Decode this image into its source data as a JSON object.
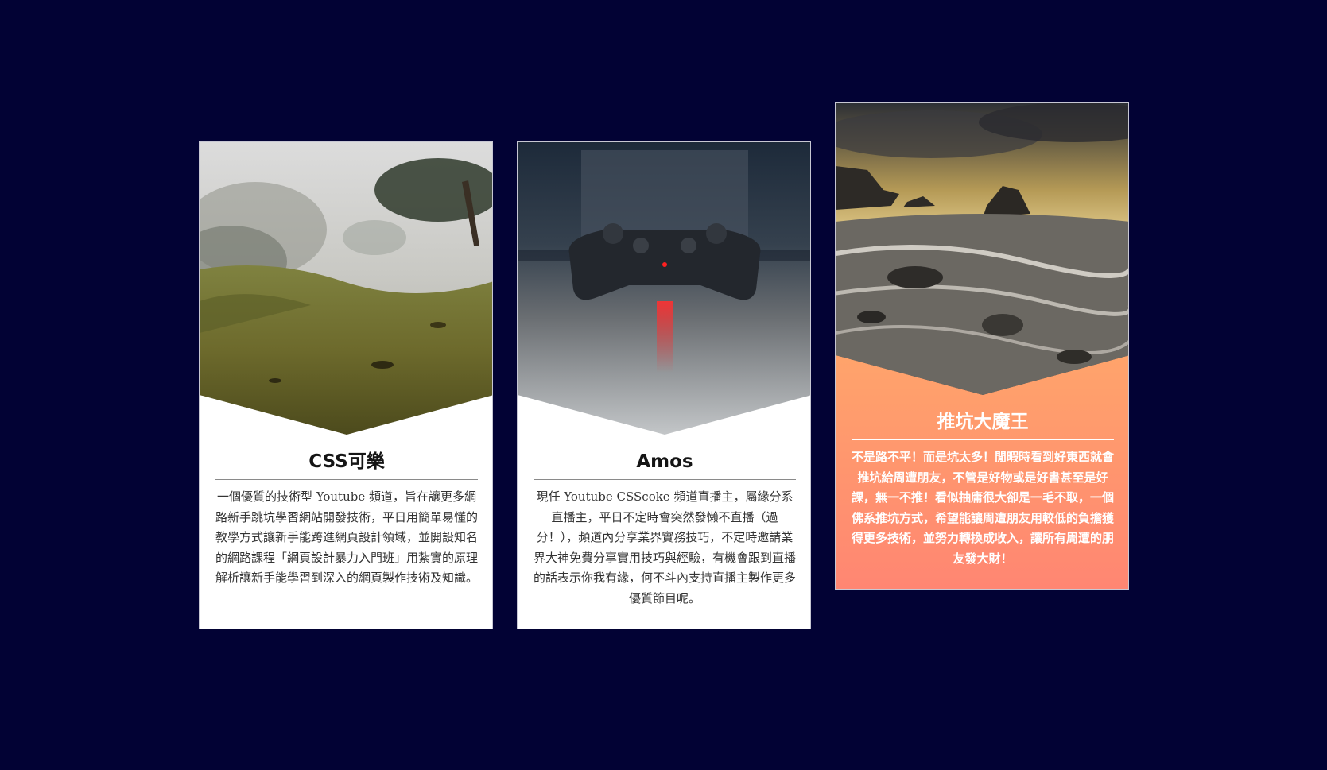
{
  "cards": [
    {
      "title": "CSS可樂",
      "text": "一個優質的技術型 Youtube 頻道，旨在讓更多網路新手跳坑學習網站開發技術，平日用簡單易懂的教學方式讓新手能跨進網頁設計領域，並開設知名的網路課程「網頁設計暴力入門班」用紮實的原理解析讓新手能學習到深入的網頁製作技術及知識。",
      "image": "misty-grassland-photo"
    },
    {
      "title": "Amos",
      "text": "現任 Youtube CSScoke 頻道直播主，屬緣分系直播主，平日不定時會突然發懶不直播（過分！），頻道內分享業界實務技巧，不定時邀請業界大神免費分享實用技巧與經驗，有機會跟到直播的話表示你我有緣，何不斗內支持直播主製作更多優質節目呢。",
      "image": "game-controller-photo"
    },
    {
      "title": "推坑大魔王",
      "text": "不是路不平！而是坑太多！閒暇時看到好東西就會推坑給周遭朋友，不管是好物或是好書甚至是好課，無一不推！看似抽庸很大卻是一毛不取，一個佛系推坑方式，希望能讓周遭朋友用較低的負擔獲得更多技術，並努力轉換成收入，讓所有周遭的朋友發大財！",
      "image": "rocky-seashore-photo"
    }
  ],
  "colors": {
    "background": "#020234",
    "card": "#ffffff",
    "highlight_gradient_top": "#ffc35c",
    "highlight_gradient_bottom": "#ff8672"
  }
}
